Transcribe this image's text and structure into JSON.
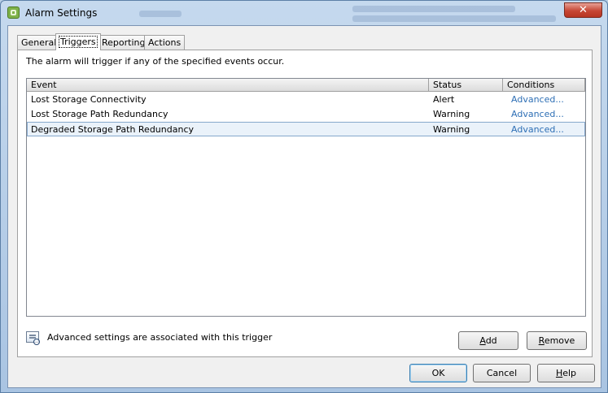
{
  "window": {
    "title": "Alarm Settings",
    "close_glyph": "✕",
    "icon": "alarm-settings-icon"
  },
  "tabs": [
    {
      "label": "General",
      "active": false
    },
    {
      "label": "Triggers",
      "active": true
    },
    {
      "label": "Reporting",
      "active": false
    },
    {
      "label": "Actions",
      "active": false
    }
  ],
  "triggers": {
    "intro": "The alarm will trigger if any of the specified events occur.",
    "columns": [
      "Event",
      "Status",
      "Conditions"
    ],
    "rows": [
      {
        "event": "Lost Storage Connectivity",
        "status": "Alert",
        "conditions": "Advanced...",
        "selected": false
      },
      {
        "event": "Lost Storage Path Redundancy",
        "status": "Warning",
        "conditions": "Advanced...",
        "selected": false
      },
      {
        "event": "Degraded Storage Path Redundancy",
        "status": "Warning",
        "conditions": "Advanced...",
        "selected": true
      }
    ],
    "info_text": "Advanced settings are associated with this trigger",
    "add": {
      "mnemonic": "A",
      "rest": "dd"
    },
    "remove": {
      "mnemonic": "R",
      "rest": "emove"
    }
  },
  "footer": {
    "ok": "OK",
    "cancel": "Cancel",
    "help": {
      "mnemonic": "H",
      "rest": "elp"
    }
  },
  "colors": {
    "link": "#2e6fb5",
    "selected_row": "#eaf2fa",
    "close_button": "#c64634"
  }
}
